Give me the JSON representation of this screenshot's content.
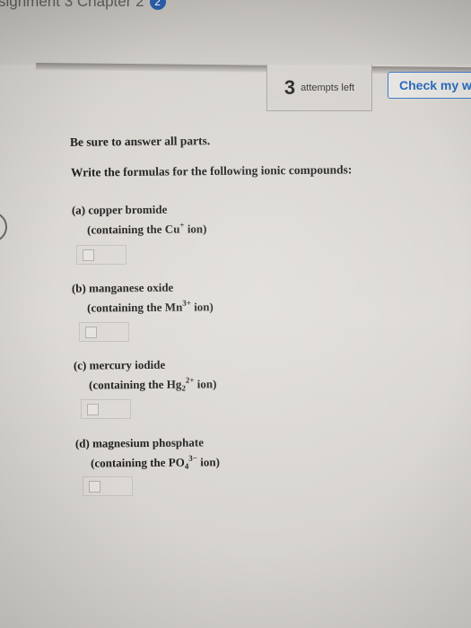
{
  "breadcrumb": {
    "text": "signment 3 Chapter 2",
    "badge": "2"
  },
  "attempts": {
    "count": "3",
    "label": "attempts left"
  },
  "check_button": {
    "label": "Check my work"
  },
  "question": {
    "instruction1": "Be sure to answer all parts.",
    "instruction2": "Write the formulas for the following ionic compounds:",
    "parts": [
      {
        "label": "(a) copper bromide",
        "hint_pre": "(containing the Cu",
        "hint_sup": "+",
        "hint_sub": "",
        "hint_post": " ion)",
        "answer": ""
      },
      {
        "label": "(b) manganese oxide",
        "hint_pre": "(containing the Mn",
        "hint_sup": "3+",
        "hint_sub": "",
        "hint_post": " ion)",
        "answer": ""
      },
      {
        "label": "(c) mercury iodide",
        "hint_pre": "(containing the Hg",
        "hint_sub": "2",
        "hint_sup": "2+",
        "hint_post": " ion)",
        "answer": ""
      },
      {
        "label": "(d) magnesium phosphate",
        "hint_pre": "(containing the PO",
        "hint_sub": "4",
        "hint_sup": "3−",
        "hint_post": " ion)",
        "answer": ""
      }
    ]
  },
  "colors": {
    "accent": "#2b6cbf",
    "text": "#1e1b1c",
    "background": "#dedbd6"
  }
}
